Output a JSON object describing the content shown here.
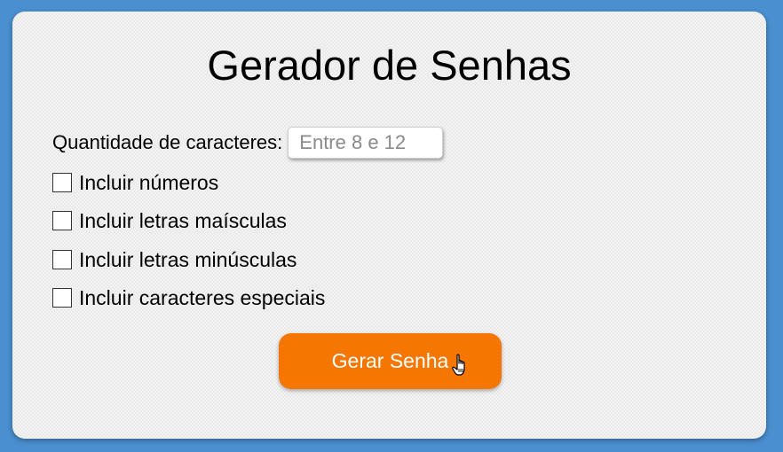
{
  "app": {
    "title": "Gerador de Senhas"
  },
  "form": {
    "quantity_label": "Quantidade de caracteres:",
    "quantity_value": "",
    "quantity_placeholder": "Entre 8 e 12",
    "options": [
      {
        "label": "Incluir números",
        "checked": false
      },
      {
        "label": "Incluir letras maísculas",
        "checked": false
      },
      {
        "label": "Incluir letras minúsculas",
        "checked": false
      },
      {
        "label": "Incluir caracteres especiais",
        "checked": false
      }
    ],
    "generate_button_label": "Gerar Senha"
  },
  "colors": {
    "background": "#4a8fcf",
    "card": "#f2f2f2",
    "button": "#f57600"
  },
  "icons": {
    "cursor": "hand-pointer-icon"
  }
}
